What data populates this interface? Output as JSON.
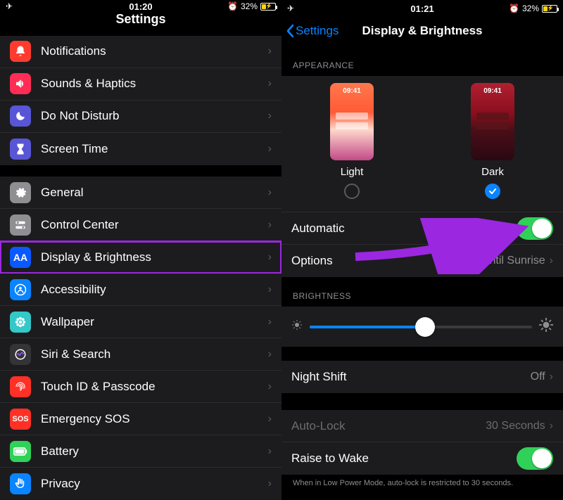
{
  "left": {
    "status": {
      "time": "01:20",
      "battery_pct": "32%",
      "battery_fill": 32
    },
    "title": "Settings",
    "group1": [
      {
        "name": "notifications",
        "label": "Notifications",
        "icon": "bell",
        "bg": "#ff3b30"
      },
      {
        "name": "sounds-haptics",
        "label": "Sounds & Haptics",
        "icon": "speaker",
        "bg": "#ff2d55"
      },
      {
        "name": "do-not-disturb",
        "label": "Do Not Disturb",
        "icon": "moon",
        "bg": "#5856d6"
      },
      {
        "name": "screen-time",
        "label": "Screen Time",
        "icon": "hourglass",
        "bg": "#5856d6"
      }
    ],
    "group2": [
      {
        "name": "general",
        "label": "General",
        "icon": "gear",
        "bg": "#8e8e93"
      },
      {
        "name": "control-center",
        "label": "Control Center",
        "icon": "switches",
        "bg": "#8e8e93"
      },
      {
        "name": "display-brightness",
        "label": "Display & Brightness",
        "icon": "aa",
        "bg": "#0a59ff",
        "highlight": true
      },
      {
        "name": "accessibility",
        "label": "Accessibility",
        "icon": "person",
        "bg": "#0a84ff"
      },
      {
        "name": "wallpaper",
        "label": "Wallpaper",
        "icon": "flower",
        "bg": "#34c8c8"
      },
      {
        "name": "siri-search",
        "label": "Siri & Search",
        "icon": "siri",
        "bg": "#343438"
      },
      {
        "name": "touch-id-passcode",
        "label": "Touch ID & Passcode",
        "icon": "fingerprint",
        "bg": "#ff3025"
      },
      {
        "name": "emergency-sos",
        "label": "Emergency SOS",
        "icon": "sos",
        "bg": "#ff3025"
      },
      {
        "name": "battery",
        "label": "Battery",
        "icon": "battery",
        "bg": "#30d158"
      },
      {
        "name": "privacy",
        "label": "Privacy",
        "icon": "hand",
        "bg": "#0a84ff"
      }
    ]
  },
  "right": {
    "status": {
      "time": "01:21",
      "battery_pct": "32%",
      "battery_fill": 32
    },
    "back_label": "Settings",
    "title": "Display & Brightness",
    "appearance_header": "APPEARANCE",
    "appearance": {
      "phone_time": "09:41",
      "light_label": "Light",
      "dark_label": "Dark",
      "selected": "dark"
    },
    "automatic_label": "Automatic",
    "automatic_on": true,
    "options_label": "Options",
    "options_value": "Dark Until Sunrise",
    "brightness_header": "BRIGHTNESS",
    "brightness_pct": 52,
    "night_shift_label": "Night Shift",
    "night_shift_value": "Off",
    "auto_lock_label": "Auto-Lock",
    "auto_lock_value": "30 Seconds",
    "raise_to_wake_label": "Raise to Wake",
    "raise_to_wake_on": true,
    "footer": "When in Low Power Mode, auto-lock is restricted to 30 seconds."
  }
}
